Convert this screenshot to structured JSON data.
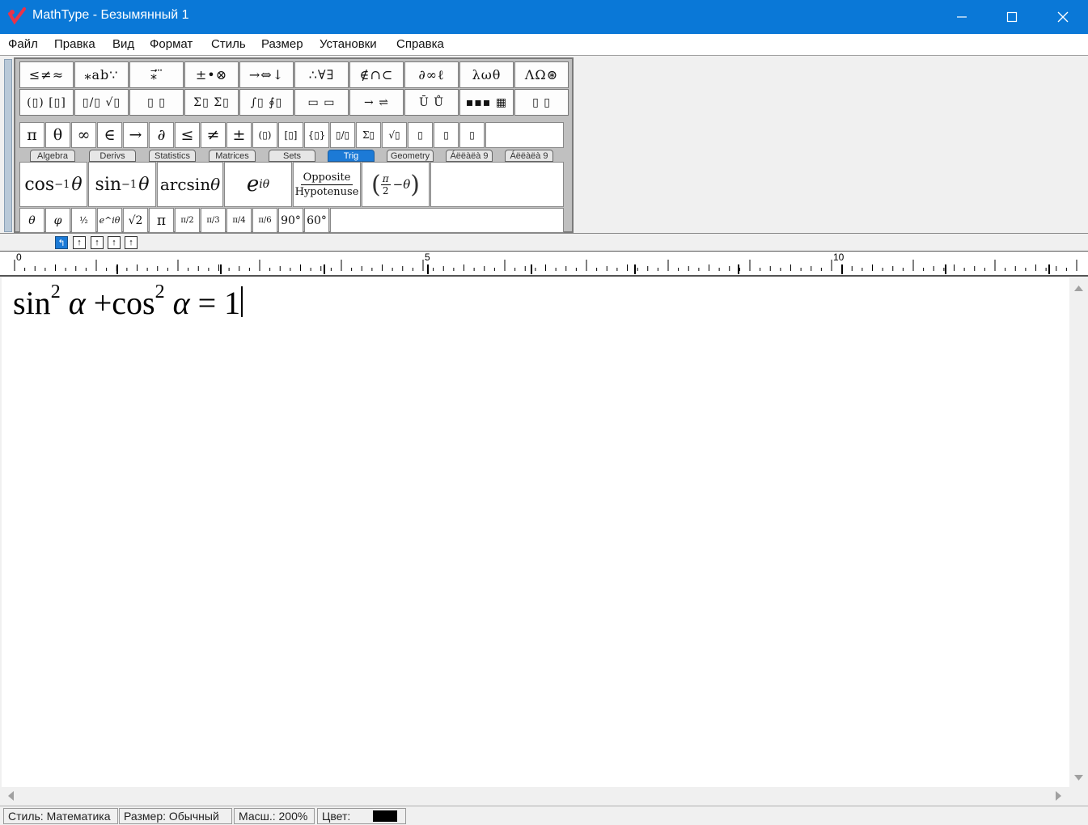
{
  "window": {
    "title": "MathType - Безымянный 1",
    "controls": {
      "minimize": "–",
      "maximize": "☐",
      "close": "✕"
    }
  },
  "menu": [
    "Файл",
    "Правка",
    "Вид",
    "Формат",
    "Стиль",
    "Размер",
    "Установки",
    "Справка"
  ],
  "toolbar": {
    "row1": [
      "≤≠≈",
      "⁎ab∵",
      "⁎⃗ ⃛",
      "±•⊗",
      "→⇔↓",
      "∴∀∃",
      "∉∩⊂",
      "∂∞ℓ",
      "λωθ",
      "ΛΩ⊛"
    ],
    "row2": [
      "(▯) [▯]",
      "▯/▯ √▯",
      "▯ ▯",
      "Σ▯ Σ▯",
      "∫▯ ∮▯",
      "▭ ▭",
      "→ ⇌",
      "Ū Ů",
      "▪▪▪ ▦",
      "▯ ▯"
    ],
    "symbols": [
      "π",
      "θ",
      "∞",
      "∈",
      "→",
      "∂",
      "≤",
      "≠",
      "±",
      "(▯)",
      "[▯]",
      "{▯}",
      "▯/▯",
      "Σ▯",
      "√▯",
      "▯",
      "▯",
      "▯"
    ],
    "tabs": [
      {
        "label": "Algebra",
        "active": false
      },
      {
        "label": "Derivs",
        "active": false
      },
      {
        "label": "Statistics",
        "active": false
      },
      {
        "label": "Matrices",
        "active": false
      },
      {
        "label": "Sets",
        "active": false
      },
      {
        "label": "Trig",
        "active": true
      },
      {
        "label": "Geometry",
        "active": false
      },
      {
        "label": "Áëëàëà 9",
        "active": false
      },
      {
        "label": "Áëëàëà 9",
        "active": false
      }
    ],
    "templates": {
      "acos": {
        "fn": "cos",
        "exp": "−1",
        "var": "θ"
      },
      "asin": {
        "fn": "sin",
        "exp": "−1",
        "var": "θ"
      },
      "arcsin": {
        "fn": "arcsin",
        "var": "θ"
      },
      "exp": {
        "base": "e",
        "exp": "iθ"
      },
      "ratio": {
        "numerator": "Opposite",
        "denominator": "Hypotenuse"
      },
      "complement": {
        "num": "π",
        "den": "2",
        "rest": "−θ"
      }
    },
    "small": [
      "θ",
      "φ",
      "½",
      "e^iθ",
      "√2",
      "π",
      "π/2",
      "π/3",
      "π/4",
      "π/6",
      "90°",
      "60°"
    ]
  },
  "tabstops": [
    "↰",
    "↑",
    "↑",
    "↑",
    "↑"
  ],
  "ruler": {
    "labels": [
      "0",
      "5",
      "10"
    ]
  },
  "equation": {
    "fn1": "sin",
    "exp1": "2",
    "var1": "α",
    "plus": "+",
    "fn2": "cos",
    "exp2": "2",
    "var2": "α",
    "eq": "=",
    "rhs": "1"
  },
  "status": {
    "style": "Стиль: Математика",
    "size": "Размер: Обычный",
    "zoom": "Масш.: 200%",
    "color": "Цвет:"
  }
}
